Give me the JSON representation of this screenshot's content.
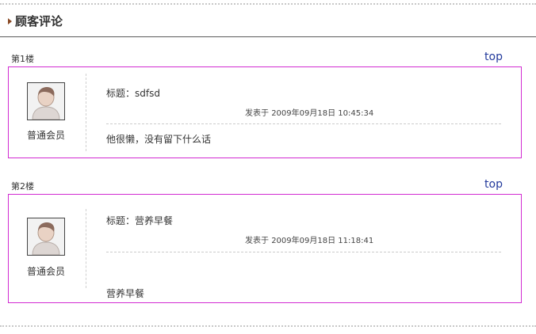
{
  "section": {
    "title": "顾客评论"
  },
  "top_label": "top",
  "comments": [
    {
      "floor": "第1楼",
      "role": "普通会员",
      "subject_label": "标题：",
      "subject": "sdfsd",
      "posted_prefix": "发表于",
      "date": "2009年09月18日 10:45:34",
      "content": "他很懒，没有留下什么话"
    },
    {
      "floor": "第2楼",
      "role": "普通会员",
      "subject_label": "标题：",
      "subject": "营养早餐",
      "posted_prefix": "发表于",
      "date": "2009年09月18日 11:18:41",
      "content": "营养早餐"
    }
  ],
  "colors": {
    "border": "#d22bd2",
    "link": "#233a9c",
    "arrow": "#8a4a25"
  },
  "icons": {
    "avatar": "default-user-avatar-icon",
    "arrow": "triangle-right-icon"
  }
}
